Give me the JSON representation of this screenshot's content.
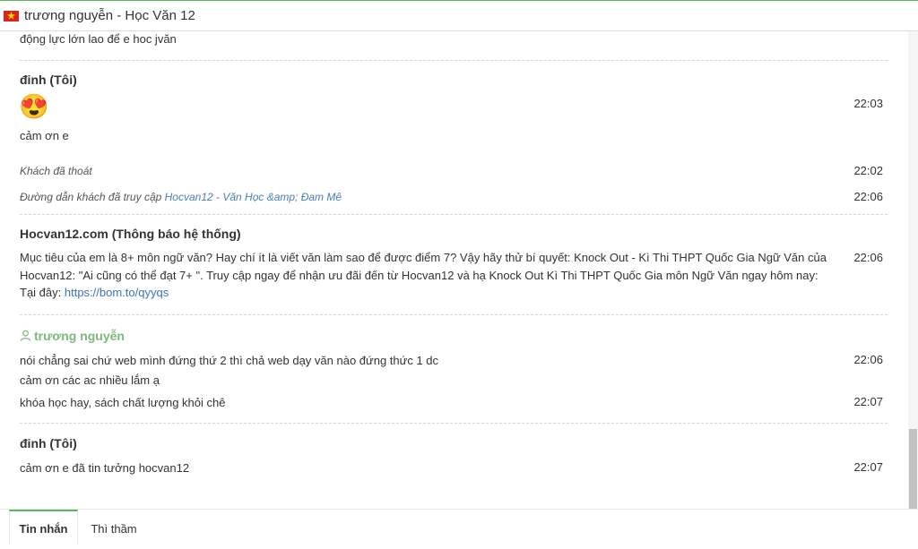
{
  "window": {
    "title": "trương nguyễn - Học Văn 12",
    "flag": "vietnam-flag-icon"
  },
  "messages": {
    "top_line": "động lực lớn lao để e hoc jvăn",
    "group1": {
      "sender": "đinh (Tôi)",
      "emoji": "😍",
      "emoji_time": "22:03",
      "text": "cảm ơn e"
    },
    "system": {
      "left": "Khách đã thoát",
      "left_time": "22:02",
      "url_prefix": "Đường dẫn khách đã truy cập",
      "url_text": "Hocvan12 - Văn Học &amp; Đam Mê",
      "url_time": "22:06"
    },
    "group2": {
      "sender": "Hocvan12.com (Thông báo hệ thống)",
      "text_line1": "Mục tiêu của em là 8+ môn ngữ văn? Hay chí ít là viết văn làm sao để được điểm 7? Vậy hãy thử bí quyết: Knock Out - Kì Thi THPT Quốc Gia Ngữ Văn của",
      "text_line2": "Hocvan12: \"Ai cũng có thể đạt 7+ \". Truy cập ngay để nhận ưu đãi đến từ Hocvan12 và hạ Knock Out Kì Thi THPT Quốc Gia môn Ngữ Văn ngay hôm nay:",
      "text_line3": "Tại đây: ",
      "link": "https://bom.to/qyyqs",
      "time": "22:06"
    },
    "group3": {
      "sender": "trương nguyễn",
      "line1": "nói chẳng sai chứ web mình đứng thứ 2 thì chả web dạy văn nào đứng thức 1 dc",
      "line1_time": "22:06",
      "line2": "cảm ơn các ac nhiều lắm ạ",
      "line3": "khóa học hay, sách chất lượng khỏi chê",
      "line3_time": "22:07"
    },
    "group4": {
      "sender": "đinh (Tôi)",
      "text": "cảm ơn e đã tin tưởng hocvan12",
      "time": "22:07"
    }
  },
  "tabs": {
    "messages": "Tin nhắn",
    "whisper": "Thì thầm"
  },
  "colors": {
    "accent": "#5cb85c",
    "visitor_name": "#7cba7c",
    "link": "#3b74b8"
  }
}
